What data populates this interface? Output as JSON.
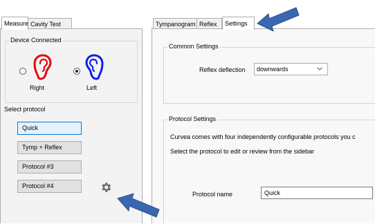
{
  "left_tabs": [
    {
      "label": "Measure",
      "selected": true
    },
    {
      "label": "Cavity Test",
      "selected": false
    }
  ],
  "device_group": {
    "title": "Device Connected",
    "right_label": "Right",
    "left_label": "Left",
    "selected": "Left",
    "right_color": "#e8000b",
    "left_color": "#0b1ee8"
  },
  "protocol": {
    "label": "Select protocol",
    "buttons": [
      "Quick",
      "Tymp + Reflex",
      "Protocol #3",
      "Protocol #4"
    ],
    "active_index": 0
  },
  "right_tabs": [
    {
      "label": "Tympanogram",
      "selected": false
    },
    {
      "label": "Reflex",
      "selected": false
    },
    {
      "label": "Settings",
      "selected": true
    }
  ],
  "common_settings": {
    "title": "Common Settings",
    "reflex_deflection_label": "Reflex deflection",
    "reflex_deflection_value": "downwards"
  },
  "protocol_settings": {
    "title": "Protocol Settings",
    "description_1": "Curvea comes with four independently configurable protocols you c",
    "description_2": "Select the protocol to edit or review from the sidebar",
    "name_label": "Protocol name",
    "name_value": "Quick"
  },
  "icons": {
    "ear_right": "ear-icon",
    "ear_left": "ear-icon",
    "settings": "gear-icon",
    "dropdown": "chevron-down-icon",
    "annotation_arrow_color": "#3a67b1"
  }
}
